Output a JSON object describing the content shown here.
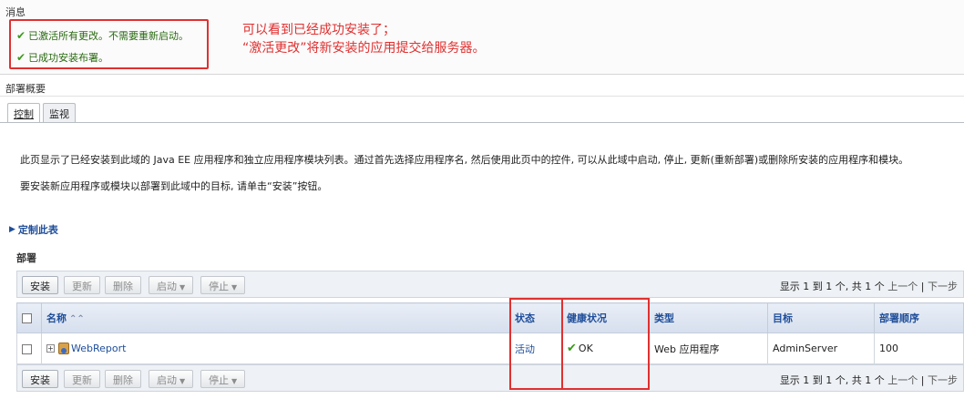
{
  "messages": {
    "title": "消息",
    "items": [
      {
        "text": "已激活所有更改。不需要重新启动。"
      },
      {
        "text": "已成功安装布署。"
      }
    ]
  },
  "annotation": {
    "line1": "可以看到已经成功安装了；",
    "line2": "“激活更改”将新安装的应用提交给服务器。"
  },
  "summary": {
    "title": "部署概要",
    "tabs": [
      {
        "label": "控制",
        "active": true
      },
      {
        "label": "监视",
        "active": false
      }
    ],
    "desc1": "此页显示了已经安装到此域的 Java EE 应用程序和独立应用程序模块列表。通过首先选择应用程序名, 然后使用此页中的控件, 可以从此域中启动, 停止, 更新(重新部署)或删除所安装的应用程序和模块。",
    "desc2": "要安装新应用程序或模块以部署到此域中的目标, 请单击“安装”按钮。",
    "customize": "定制此表"
  },
  "deployments": {
    "title": "部署",
    "toolbar": {
      "install": "安装",
      "update": "更新",
      "delete": "删除",
      "start": "启动",
      "stop": "停止"
    },
    "pager": {
      "info": "显示 1 到 1 个, 共 1 个",
      "prev": "上一个",
      "sep": "|",
      "next": "下一步"
    },
    "columns": {
      "name": "名称",
      "state": "状态",
      "health": "健康状况",
      "type": "类型",
      "target": "目标",
      "order": "部署顺序"
    },
    "rows": [
      {
        "name": "WebReport",
        "state": "活动",
        "health": "OK",
        "type": "Web 应用程序",
        "target": "AdminServer",
        "order": "100"
      }
    ]
  },
  "colors": {
    "annotation_red": "#e03030",
    "link_blue": "#1f4e9a",
    "success_green": "#3a9a1a"
  }
}
